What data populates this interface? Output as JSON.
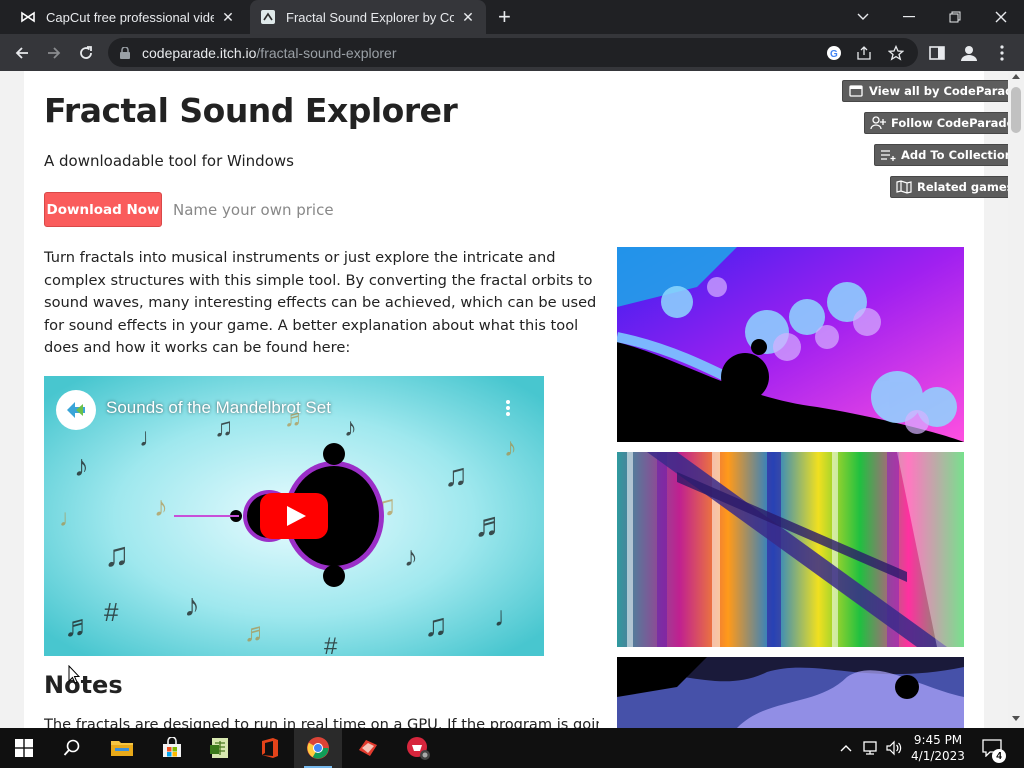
{
  "browser": {
    "tabs": [
      {
        "title": "CapCut free professional video editor",
        "favicon": "capcut-icon",
        "active": false
      },
      {
        "title": "Fractal Sound Explorer by CodeParade",
        "favicon": "itchio-icon",
        "active": true
      }
    ],
    "url_host": "codeparade.itch.io",
    "url_path": "/fractal-sound-explorer"
  },
  "page": {
    "title": "Fractal Sound Explorer",
    "subtitle": "A downloadable tool for Windows",
    "download_label": "Download Now",
    "price_label": "Name your own price",
    "side_buttons": {
      "view_all": "View all by CodeParade",
      "follow": "Follow CodeParade",
      "add_collection": "Add To Collection",
      "related": "Related games"
    },
    "description": "Turn fractals into musical instruments or just explore the intricate and complex structures with this simple tool.  By converting the fractal orbits to sound waves, many interesting effects can be achieved, which can be used for sound effects in your game.  A better explanation about what this tool does and how it works can be found here:",
    "video_title": "Sounds of the Mandelbrot Set",
    "notes_heading": "Notes",
    "notes_text": "The fractals are designed to run in real time on a GPU. If the program is going"
  },
  "taskbar": {
    "time": "9:45 PM",
    "date": "4/1/2023",
    "notification_count": "4"
  },
  "colors": {
    "download_button": "#fa5c5c",
    "side_button": "#5d5d5d",
    "chrome_dark": "#202124",
    "chrome_toolbar": "#35363a"
  }
}
